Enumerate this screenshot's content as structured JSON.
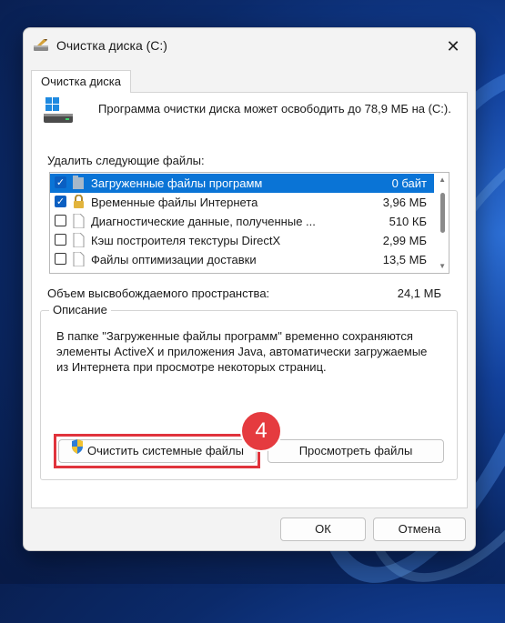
{
  "window": {
    "title": "Очистка диска  (C:)",
    "tab_label": "Очистка диска",
    "close_glyph": "✕"
  },
  "intro_text": "Программа очистки диска может освободить до 78,9 МБ на (C:).",
  "delete_label": "Удалить следующие файлы:",
  "files": [
    {
      "name": "Загруженные файлы программ",
      "size": "0 байт",
      "checked": true,
      "selected": true,
      "icon": "folder-icon"
    },
    {
      "name": "Временные файлы Интернета",
      "size": "3,96 МБ",
      "checked": true,
      "selected": false,
      "icon": "lock-icon"
    },
    {
      "name": "Диагностические данные, полученные ...",
      "size": "510 КБ",
      "checked": false,
      "selected": false,
      "icon": "file-icon"
    },
    {
      "name": "Кэш построителя текстуры DirectX",
      "size": "2,99 МБ",
      "checked": false,
      "selected": false,
      "icon": "file-icon"
    },
    {
      "name": "Файлы оптимизации доставки",
      "size": "13,5 МБ",
      "checked": false,
      "selected": false,
      "icon": "file-icon"
    }
  ],
  "space_label": "Объем высвобождаемого пространства:",
  "space_value": "24,1 МБ",
  "description": {
    "label": "Описание",
    "text": "В папке \"Загруженные файлы программ\" временно сохраняются элементы ActiveX и приложения Java, автоматически загружаемые из Интернета при просмотре некоторых страниц."
  },
  "buttons": {
    "clean_system": "Очистить системные файлы",
    "view_files": "Просмотреть файлы",
    "ok": "ОК",
    "cancel": "Отмена"
  },
  "annotation": {
    "step_number": "4",
    "color": "#e53b3f"
  },
  "colors": {
    "selection": "#0a74d6",
    "checkbox": "#0a5fc2"
  }
}
